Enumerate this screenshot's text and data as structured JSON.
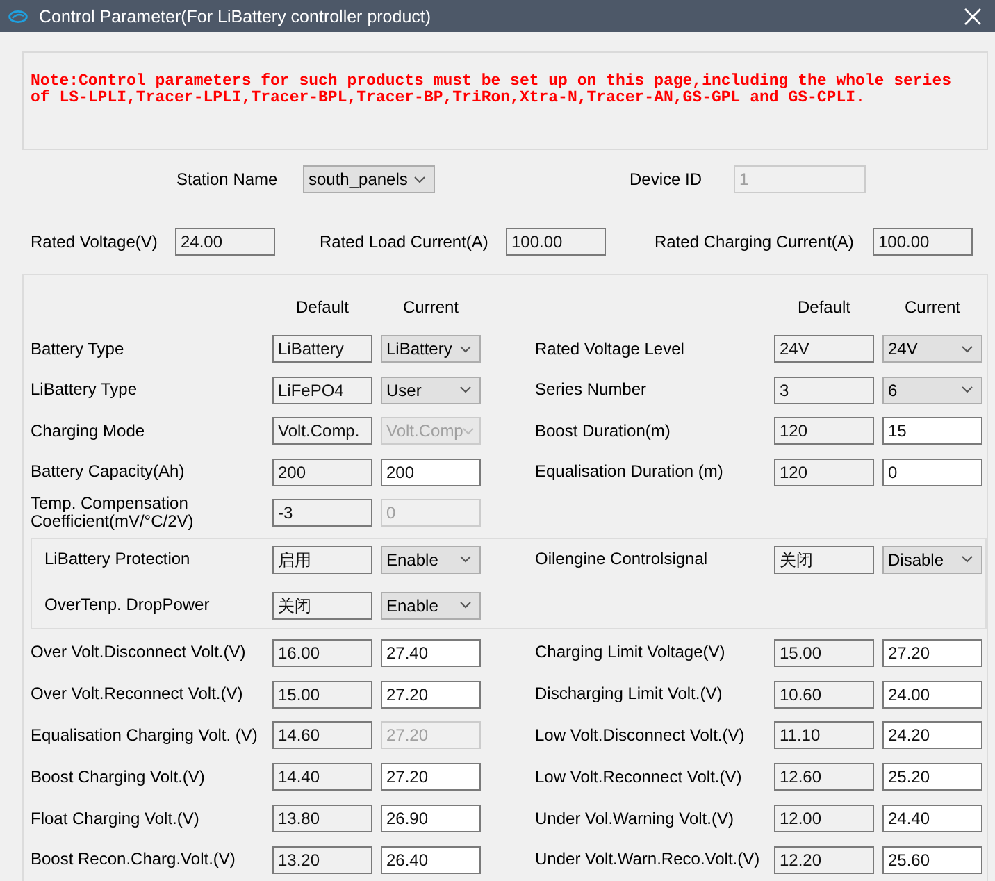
{
  "window": {
    "title": "Control Parameter(For LiBattery controller product)"
  },
  "note": "Note:Control parameters for such products must be set up on this page,including the whole series of LS-LPLI,Tracer-LPLI,Tracer-BPL,Tracer-BP,TriRon,Xtra-N,Tracer-AN,GS-GPL and GS-CPLI.",
  "station": {
    "label": "Station Name",
    "value": "south_panels"
  },
  "device_id": {
    "label": "Device ID",
    "value": "1",
    "disabled": true
  },
  "rated": [
    {
      "label": "Rated Voltage(V)",
      "value": "24.00"
    },
    {
      "label": "Rated Load Current(A)",
      "value": "100.00"
    },
    {
      "label": "Rated Charging Current(A)",
      "value": "100.00"
    }
  ],
  "settings": {
    "left": {
      "headers": [
        "Default",
        "Current"
      ],
      "rows": [
        {
          "label": "Battery Type",
          "default": "LiBattery",
          "current": "LiBattery",
          "kind": "select",
          "disabled": false
        },
        {
          "label": "LiBattery Type",
          "default": "LiFePO4",
          "current": "User",
          "kind": "select",
          "disabled": false
        },
        {
          "label": "Charging Mode",
          "default": "Volt.Comp.",
          "current": "Volt.Comp",
          "kind": "select",
          "disabled": true
        },
        {
          "label": "Battery Capacity(Ah)",
          "default": "200",
          "current": "200",
          "kind": "text",
          "disabled": false
        },
        {
          "label": "Temp. Compensation Coefficient(mV/°C/2V)",
          "default": "-3",
          "current": "0",
          "kind": "text",
          "disabled": true
        }
      ]
    },
    "right": {
      "headers": [
        "Default",
        "Current"
      ],
      "rows": [
        {
          "label": "Rated Voltage Level",
          "default": "24V",
          "current": "24V",
          "kind": "select",
          "disabled": false
        },
        {
          "label": "Series Number",
          "default": "3",
          "current": "6",
          "kind": "select",
          "disabled": false
        },
        {
          "label": "Boost Duration(m)",
          "default": "120",
          "current": "15",
          "kind": "text",
          "disabled": false
        },
        {
          "label": "Equalisation Duration (m)",
          "default": "120",
          "current": "0",
          "kind": "text",
          "disabled": false
        }
      ]
    }
  },
  "protection": {
    "left": [
      {
        "label": "LiBattery Protection",
        "default": "启用",
        "current": "Enable",
        "kind": "select",
        "disabled": false
      },
      {
        "label": "OverTenp. DropPower",
        "default": "关闭",
        "current": "Enable",
        "kind": "select",
        "disabled": false
      }
    ],
    "right": [
      {
        "label": "Oilengine Controlsignal",
        "default": "关闭",
        "current": "Disable",
        "kind": "select",
        "disabled": false
      }
    ]
  },
  "voltages": {
    "left": [
      {
        "label": "Over Volt.Disconnect Volt.(V)",
        "default": "16.00",
        "current": "27.40",
        "kind": "text",
        "disabled": false
      },
      {
        "label": "Over Volt.Reconnect Volt.(V)",
        "default": "15.00",
        "current": "27.20",
        "kind": "text",
        "disabled": false
      },
      {
        "label": "Equalisation Charging Volt. (V)",
        "default": "14.60",
        "current": "27.20",
        "kind": "text",
        "disabled": true
      },
      {
        "label": "Boost Charging Volt.(V)",
        "default": "14.40",
        "current": "27.20",
        "kind": "text",
        "disabled": false
      },
      {
        "label": "Float Charging Volt.(V)",
        "default": "13.80",
        "current": "26.90",
        "kind": "text",
        "disabled": false
      },
      {
        "label": "Boost Recon.Charg.Volt.(V)",
        "default": "13.20",
        "current": "26.40",
        "kind": "text",
        "disabled": false
      }
    ],
    "right": [
      {
        "label": "Charging Limit Voltage(V)",
        "default": "15.00",
        "current": "27.20",
        "kind": "text",
        "disabled": false
      },
      {
        "label": "Discharging Limit Volt.(V)",
        "default": "10.60",
        "current": "24.00",
        "kind": "text",
        "disabled": false
      },
      {
        "label": "Low Volt.Disconnect Volt.(V)",
        "default": "11.10",
        "current": "24.20",
        "kind": "text",
        "disabled": false
      },
      {
        "label": "Low Volt.Reconnect Volt.(V)",
        "default": "12.60",
        "current": "25.20",
        "kind": "text",
        "disabled": false
      },
      {
        "label": "Under Vol.Warning Volt.(V)",
        "default": "12.00",
        "current": "24.40",
        "kind": "text",
        "disabled": false
      },
      {
        "label": "Under Volt.Warn.Reco.Volt.(V)",
        "default": "12.20",
        "current": "25.60",
        "kind": "text",
        "disabled": false
      }
    ]
  }
}
